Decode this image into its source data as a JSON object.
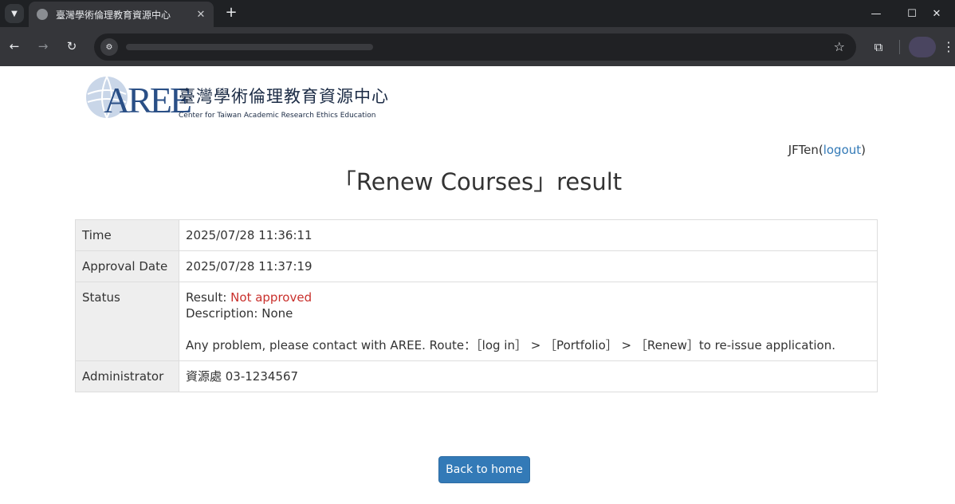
{
  "browser": {
    "tab_title": "臺灣學術倫理教育資源中心",
    "tab_close": "✕",
    "new_tab": "+",
    "window_controls": {
      "minimize": "—",
      "maximize": "☐",
      "close": "✕"
    }
  },
  "logo": {
    "mark": "AREE",
    "name_cn": "臺灣學術倫理教育資源中心",
    "name_en": "Center for Taiwan Academic Research Ethics Education"
  },
  "user": {
    "name": "JFTen",
    "open_paren": "(",
    "logout_label": "logout",
    "close_paren": ")"
  },
  "page_title": "「Renew Courses」result",
  "details": {
    "time_label": "Time",
    "time_value": "2025/07/28 11:36:11",
    "approval_label": "Approval Date",
    "approval_value": "2025/07/28 11:37:19",
    "status_label": "Status",
    "result_prefix": "Result: ",
    "result_value": "Not approved",
    "description_prefix": "Description: ",
    "description_value": "None",
    "contact_note": "Any problem, please contact with AREE. Route：［log in］ > ［Portfolio］ > ［Renew］to re-issue application.",
    "admin_label": "Administrator",
    "admin_value": "資源處 03-1234567"
  },
  "back_home_label": "Back to home",
  "colors": {
    "primary_button": "#337ab7",
    "status_red": "#c9302c",
    "link": "#337ab7"
  }
}
